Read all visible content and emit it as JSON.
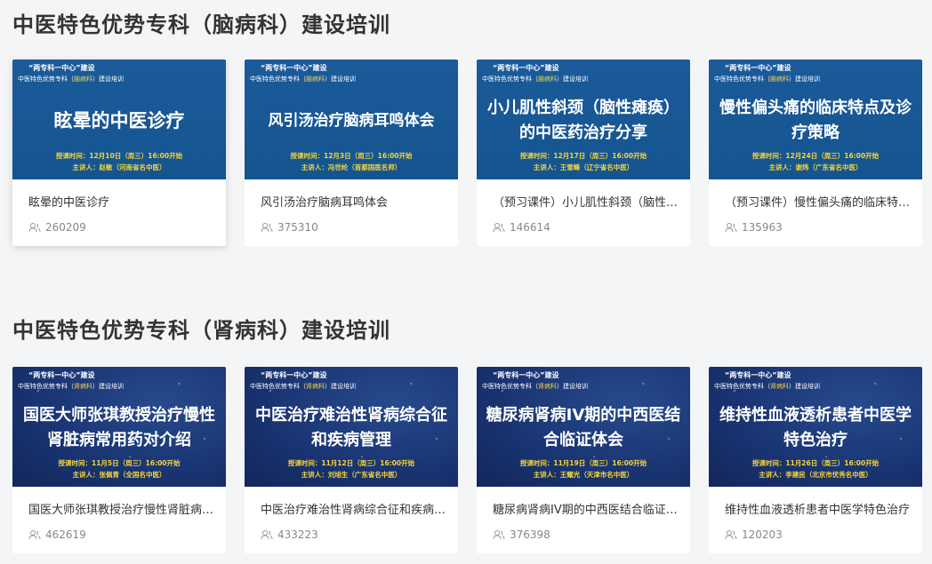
{
  "sections": [
    {
      "title": "中医特色优势专科（脑病科）建设培训",
      "theme": "neuro",
      "courses": [
        {
          "banner_top": "“两专科一中心”建设",
          "banner_sub_pre": "中医特色优势专科（",
          "banner_sub_hl": "脑病科",
          "banner_sub_post": "）建设培训",
          "banner_title": "眩晕的中医诊疗",
          "banner_time": "授课时间：12月10日（周三）16:00开始",
          "banner_lecturer": "主讲人：赵敏（河南省名中医）",
          "title": "眩晕的中医诊疗",
          "views": "260209"
        },
        {
          "banner_top": "“两专科一中心”建设",
          "banner_sub_pre": "中医特色优势专科（",
          "banner_sub_hl": "脑病科",
          "banner_sub_post": "）建设培训",
          "banner_title": "风引汤治疗脑病耳鸣体会",
          "banner_time": "授课时间：12月3日（周三）16:00开始",
          "banner_lecturer": "主讲人：冯世纶（首都国医名师）",
          "title": "风引汤治疗脑病耳鸣体会",
          "views": "375310"
        },
        {
          "banner_top": "“两专科一中心”建设",
          "banner_sub_pre": "中医特色优势专科（",
          "banner_sub_hl": "脑病科",
          "banner_sub_post": "）建设培训",
          "banner_title": "小儿肌性斜颈（脑性瘫痪）的中医药治疗分享",
          "banner_time": "授课时间：12月17日（周三）16:00开始",
          "banner_lecturer": "主讲人：王雪峰（辽宁省名中医）",
          "title": "（预习课件）小儿肌性斜颈（脑性瘫痪）的中医药治疗分享",
          "views": "146614"
        },
        {
          "banner_top": "“两专科一中心”建设",
          "banner_sub_pre": "中医特色优势专科（",
          "banner_sub_hl": "脑病科",
          "banner_sub_post": "）建设培训",
          "banner_title": "慢性偏头痛的临床特点及诊疗策略",
          "banner_time": "授课时间：12月24日（周三）16:00开始",
          "banner_lecturer": "主讲人：谢炜（广东省名中医）",
          "title": "（预习课件）慢性偏头痛的临床特点及诊疗策略",
          "views": "135963"
        }
      ]
    },
    {
      "title": "中医特色优势专科（肾病科）建设培训",
      "theme": "renal",
      "courses": [
        {
          "banner_top": "“两专科一中心”建设",
          "banner_sub_pre": "中医特色优势专科（",
          "banner_sub_hl": "肾病科",
          "banner_sub_post": "）建设培训",
          "banner_title": "国医大师张琪教授治疗慢性肾脏病常用药对介绍",
          "banner_time": "授课时间：11月5日（周三）16:00开始",
          "banner_lecturer": "主讲人：张佩青（全国名中医）",
          "title": "国医大师张琪教授治疗慢性肾脏病常用药对介绍",
          "views": "462619"
        },
        {
          "banner_top": "“两专科一中心”建设",
          "banner_sub_pre": "中医特色优势专科（",
          "banner_sub_hl": "肾病科",
          "banner_sub_post": "）建设培训",
          "banner_title": "中医治疗难治性肾病综合征和疾病管理",
          "banner_time": "授课时间：11月12日（周三）16:00开始",
          "banner_lecturer": "主讲人：刘旭生（广东省名中医）",
          "title": "中医治疗难治性肾病综合征和疾病管理",
          "views": "433223"
        },
        {
          "banner_top": "“两专科一中心”建设",
          "banner_sub_pre": "中医特色优势专科（",
          "banner_sub_hl": "肾病科",
          "banner_sub_post": "）建设培训",
          "banner_title": "糖尿病肾病IV期的中西医结合临证体会",
          "banner_time": "授课时间：11月19日（周三）16:00开始",
          "banner_lecturer": "主讲人：王耀光（天津市名中医）",
          "title": "糖尿病肾病IV期的中西医结合临证体会",
          "views": "376398"
        },
        {
          "banner_top": "“两专科一中心”建设",
          "banner_sub_pre": "中医特色优势专科（",
          "banner_sub_hl": "肾病科",
          "banner_sub_post": "）建设培训",
          "banner_title": "维持性血液透析患者中医学特色治疗",
          "banner_time": "授课时间：11月26日（周三）16:00开始",
          "banner_lecturer": "主讲人：李建民（北京市优秀名中医）",
          "title": "维持性血液透析患者中医学特色治疗",
          "views": "120203"
        }
      ]
    }
  ],
  "icons": {
    "views": "viewer-icon"
  },
  "colors": {
    "background": "#f4f5f7",
    "banner_highlight": "#f5d33b",
    "neuro_banner": "#14558f",
    "renal_banner": "#1a3574"
  }
}
